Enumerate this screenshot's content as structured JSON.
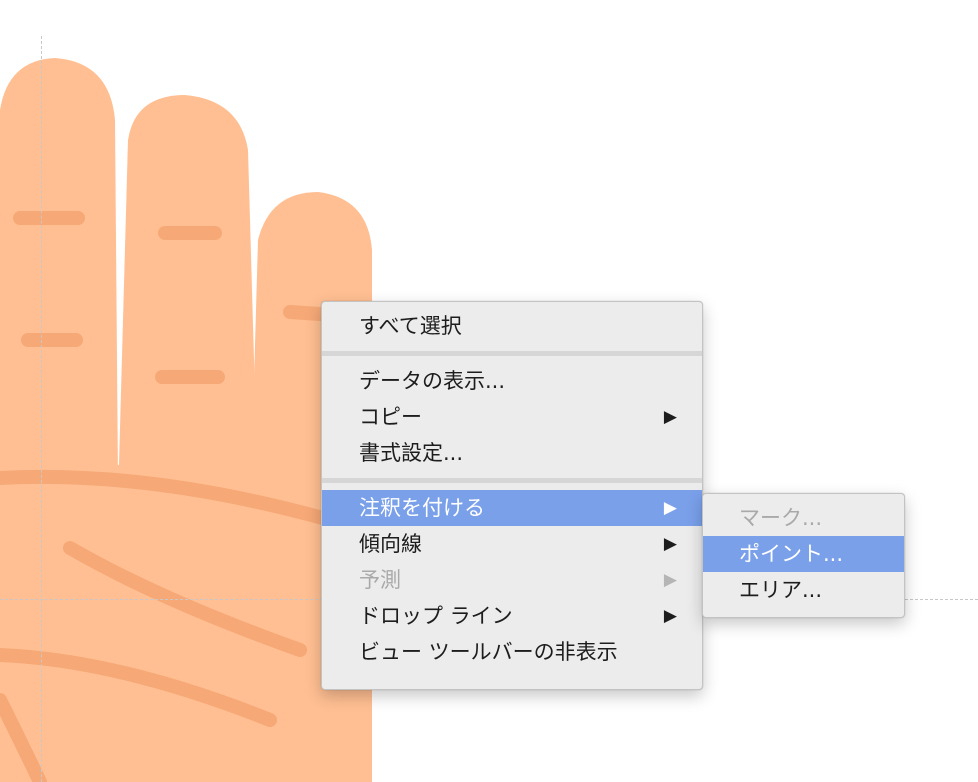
{
  "context_menu": {
    "items": [
      {
        "label": "すべて選択"
      },
      {
        "label": "データの表示..."
      },
      {
        "label": "コピー",
        "submenu_arrow": "▶"
      },
      {
        "label": "書式設定..."
      },
      {
        "label": "注釈を付ける",
        "submenu_arrow": "▶",
        "state": "highlighted"
      },
      {
        "label": "傾向線",
        "submenu_arrow": "▶"
      },
      {
        "label": "予測",
        "submenu_arrow": "▶",
        "state": "disabled"
      },
      {
        "label": "ドロップ ライン",
        "submenu_arrow": "▶"
      },
      {
        "label": "ビュー ツールバーの非表示"
      }
    ]
  },
  "annotate_submenu": {
    "items": [
      {
        "label": "マーク...",
        "state": "disabled"
      },
      {
        "label": "ポイント...",
        "state": "highlighted"
      },
      {
        "label": "エリア..."
      }
    ]
  },
  "colors": {
    "menu_background": "#ececec",
    "highlight": "#7aa0ea",
    "disabled_text": "#a9a9a9",
    "skin": "#ffbf92",
    "palm_line": "#f5a472"
  },
  "icons": {
    "submenu_arrow": "black-right-pointing-triangle",
    "background": "hand-illustration"
  }
}
